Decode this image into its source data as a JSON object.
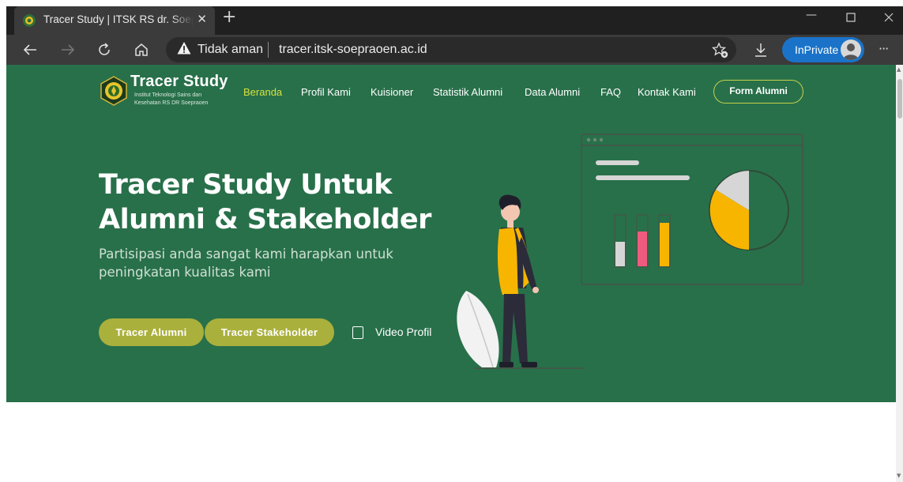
{
  "browser": {
    "tab_title": "Tracer Study | ITSK RS dr. Soepraoen",
    "tab_close": "✕",
    "new_tab": "+",
    "security_label": "Tidak aman",
    "url": "tracer.itsk-soepraoen.ac.id",
    "inprivate_label": "InPrivate",
    "more": "···",
    "icons": [
      "back-icon",
      "forward-icon",
      "refresh-icon",
      "home-icon",
      "warning-icon",
      "favorite-icon",
      "download-icon",
      "avatar"
    ]
  },
  "site": {
    "brand_title": "Tracer Study",
    "brand_sub": "Institut Teknologi Sains dan Kesehatan RS DR Soepraoen",
    "nav": [
      {
        "label": "Beranda"
      },
      {
        "label": "Profil Kami"
      },
      {
        "label": "Kuisioner"
      },
      {
        "label": "Statistik Alumni"
      },
      {
        "label": "Data Alumni"
      },
      {
        "label": "FAQ"
      },
      {
        "label": "Kontak Kami"
      }
    ],
    "form_button": "Form Alumni"
  },
  "hero": {
    "title": "Tracer Study Untuk Alumni & Stakeholder",
    "subtitle": "Partisipasi anda sangat kami harapkan untuk peningkatan kualitas kami",
    "buttons": [
      {
        "label": "Tracer Alumni"
      },
      {
        "label": "Tracer Stakeholder"
      }
    ],
    "video_label": "Video Profil"
  },
  "colors": {
    "hero_bg": "#28704a",
    "nav_active": "#d7e03f",
    "button": "#aab03c",
    "accent_yellow": "#f7b500",
    "accent_pink": "#ef5b7f"
  }
}
